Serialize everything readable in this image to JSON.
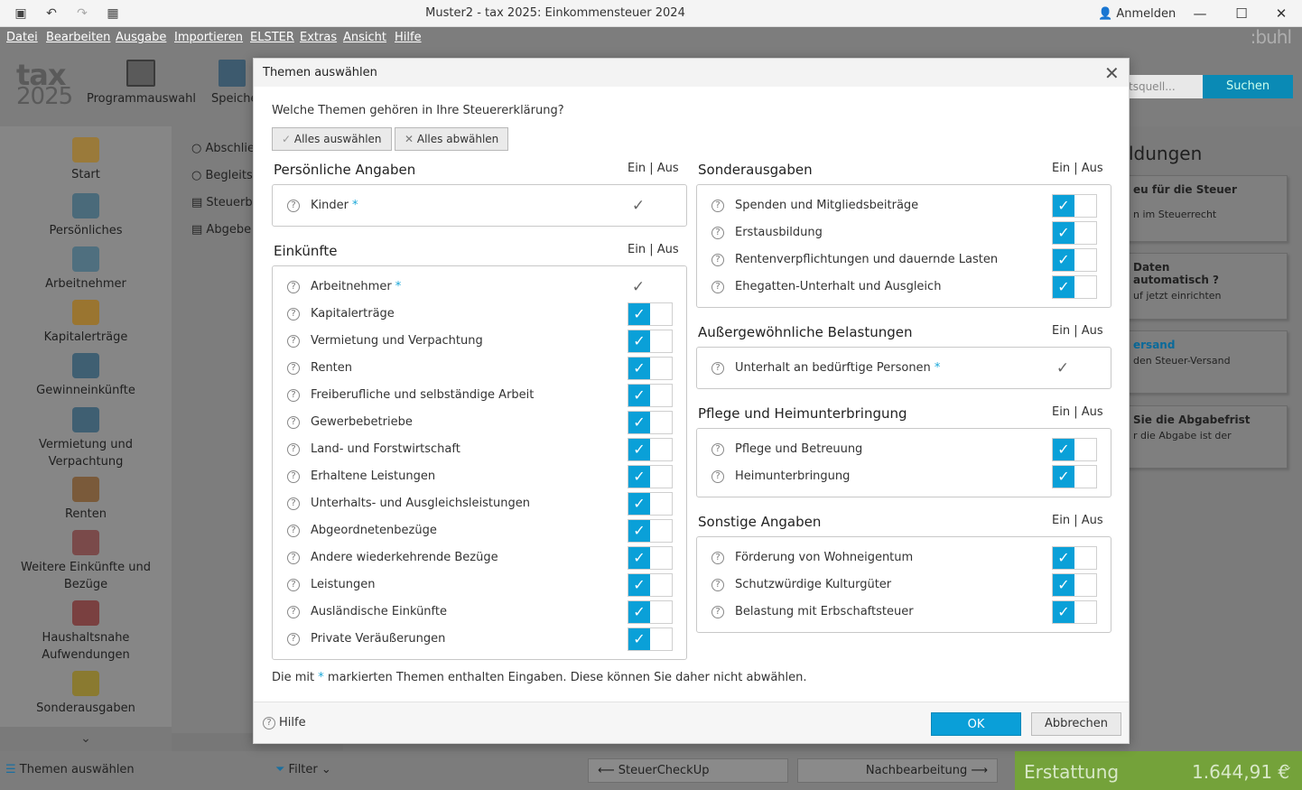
{
  "window": {
    "title": "Muster2 - tax 2025: Einkommensteuer 2024",
    "login": "Anmelden"
  },
  "menu": [
    "Datei",
    "Bearbeiten",
    "Ausgabe",
    "Importieren",
    "ELSTER",
    "Extras",
    "Ansicht",
    "Hilfe"
  ],
  "brand": ":buhl",
  "logo": {
    "line1": "tax",
    "line2": "2025"
  },
  "toolbar": {
    "programmauswahl": "Programmauswahl",
    "speichern": "Speiche",
    "search_placeholder": "tsquell...",
    "search_button": "Suchen"
  },
  "sidebar": [
    "Start",
    "Persönliches",
    "Arbeitnehmer",
    "Kapitalerträge",
    "Gewinneinkünfte",
    "Vermietung und Verpachtung",
    "Renten",
    "Weitere Einkünfte und Bezüge",
    "Haushaltsnahe Aufwendungen",
    "Sonderausgaben"
  ],
  "main_left": [
    "Abschlie",
    "Begleits",
    "Steuerb",
    "Abgebe"
  ],
  "right_panel": {
    "heading": "ldungen",
    "cards": [
      {
        "title": "eu für die Steuer",
        "text": "n im Steuerrecht"
      },
      {
        "title": "Daten automatisch ?",
        "text": "uf jetzt einrichten"
      },
      {
        "title": "ersand",
        "text": "den Steuer-Versand"
      },
      {
        "title": "Sie die Abgabefrist",
        "text": "r die Abgabe ist der"
      }
    ]
  },
  "bottom": {
    "themen": "Themen auswählen",
    "filter": "Filter",
    "checkup": "SteuerCheckUp",
    "nachbearbeitung": "Nachbearbeitung",
    "erstattung": "Erstattung",
    "amount": "1.644,91 €"
  },
  "dialog": {
    "title": "Themen auswählen",
    "question": "Welche Themen gehören in Ihre Steuererklärung?",
    "select_all": "Alles auswählen",
    "deselect_all": "Alles abwählen",
    "ein_aus": "Ein | Aus",
    "footnote_pre": "Die mit",
    "footnote_star": "*",
    "footnote_post": "markierten Themen enthalten Eingaben. Diese können Sie daher nicht abwählen.",
    "help": "Hilfe",
    "ok": "OK",
    "cancel": "Abbrechen",
    "sections": {
      "persoenlich": {
        "title": "Persönliche Angaben",
        "items": [
          {
            "label": "Kinder",
            "star": true
          }
        ]
      },
      "einkuenfte": {
        "title": "Einkünfte",
        "items": [
          {
            "label": "Arbeitnehmer",
            "star": true
          },
          {
            "label": "Kapitalerträge"
          },
          {
            "label": "Vermietung und Verpachtung"
          },
          {
            "label": "Renten"
          },
          {
            "label": "Freiberufliche und selbständige Arbeit"
          },
          {
            "label": "Gewerbebetriebe"
          },
          {
            "label": "Land- und Forstwirtschaft"
          },
          {
            "label": "Erhaltene Leistungen"
          },
          {
            "label": "Unterhalts- und Ausgleichsleistungen"
          },
          {
            "label": "Abgeordnetenbezüge"
          },
          {
            "label": "Andere wiederkehrende Bezüge"
          },
          {
            "label": "Leistungen"
          },
          {
            "label": "Ausländische Einkünfte"
          },
          {
            "label": "Private Veräußerungen"
          }
        ]
      },
      "sonderausgaben": {
        "title": "Sonderausgaben",
        "items": [
          {
            "label": "Spenden und Mitgliedsbeiträge"
          },
          {
            "label": "Erstausbildung"
          },
          {
            "label": "Rentenverpflichtungen und dauernde Lasten"
          },
          {
            "label": "Ehegatten-Unterhalt und Ausgleich"
          }
        ]
      },
      "belastungen": {
        "title": "Außergewöhnliche Belastungen",
        "items": [
          {
            "label": "Unterhalt an bedürftige Personen",
            "star": true
          }
        ]
      },
      "pflege": {
        "title": "Pflege und Heimunterbringung",
        "items": [
          {
            "label": "Pflege und Betreuung"
          },
          {
            "label": "Heimunterbringung"
          }
        ]
      },
      "sonstige": {
        "title": "Sonstige Angaben",
        "items": [
          {
            "label": "Förderung von Wohneigentum"
          },
          {
            "label": "Schutzwürdige Kulturgüter"
          },
          {
            "label": "Belastung mit Erbschaftsteuer"
          }
        ]
      }
    }
  },
  "colors": {
    "accent": "#0aa0d8",
    "erstattung": "#74a23a"
  }
}
